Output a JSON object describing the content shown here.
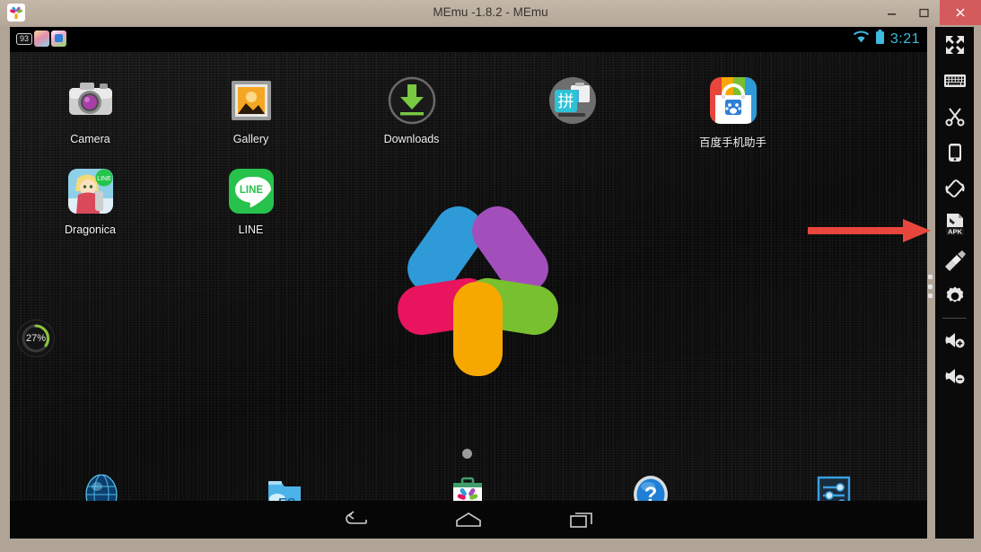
{
  "window": {
    "title": "MEmu -1.8.2 - MEmu",
    "app_icon": "memu-pinwheel-icon",
    "controls": {
      "minimize": "–",
      "maximize": "☐",
      "close": "✕"
    }
  },
  "status_bar": {
    "notification_count": "93",
    "notification_icons": [
      "dragonica-notification-icon",
      "baidu-notification-icon"
    ],
    "wifi_icon": "wifi-icon",
    "battery_icon": "battery-icon",
    "clock": "3:21",
    "accent_color": "#3fb9dd"
  },
  "performance_badge": {
    "value": "27%",
    "arc_color": "#8cc63f"
  },
  "home_screen": {
    "page_indicator_dots": 1,
    "apps": [
      {
        "label": "Camera",
        "icon": "camera-icon"
      },
      {
        "label": "Gallery",
        "icon": "gallery-icon"
      },
      {
        "label": "Downloads",
        "icon": "downloads-icon"
      },
      {
        "label": "",
        "icon": "pinyin-briefcase-icon"
      },
      {
        "label": "百度手机助手",
        "icon": "baidu-mobile-assistant-icon"
      },
      {
        "label": "Dragonica",
        "icon": "dragonica-icon"
      },
      {
        "label": "LINE",
        "icon": "line-icon"
      }
    ],
    "dock": [
      {
        "name": "Browser",
        "icon": "browser-globe-icon"
      },
      {
        "name": "ES File Explorer",
        "icon": "es-file-explorer-icon",
        "badge": "ES"
      },
      {
        "name": "App Store",
        "icon": "appstore-briefcase-icon"
      },
      {
        "name": "Help",
        "icon": "help-question-icon"
      },
      {
        "name": "Settings",
        "icon": "settings-sliders-icon"
      }
    ],
    "nav_bar": [
      {
        "name": "Back",
        "icon": "back-arrow-icon"
      },
      {
        "name": "Home",
        "icon": "home-icon"
      },
      {
        "name": "Recents",
        "icon": "recents-icon"
      }
    ],
    "logo": {
      "name": "memu-pinwheel-logo",
      "petal_colors": [
        "#2f9ad8",
        "#a24fbc",
        "#e8145e",
        "#79c030",
        "#f6a800"
      ]
    }
  },
  "toolbar": {
    "buttons": [
      {
        "name": "fullscreen",
        "icon": "fullscreen-icon"
      },
      {
        "name": "keyboard",
        "icon": "keyboard-icon"
      },
      {
        "name": "screenshot",
        "icon": "scissors-icon"
      },
      {
        "name": "shake",
        "icon": "phone-shake-icon"
      },
      {
        "name": "rotate",
        "icon": "rotate-icon"
      },
      {
        "name": "install-apk",
        "icon": "apk-install-icon",
        "label": "APK"
      },
      {
        "name": "clean",
        "icon": "brush-icon"
      },
      {
        "name": "settings",
        "icon": "gear-icon"
      },
      {
        "name": "volume-up",
        "icon": "volume-up-icon"
      },
      {
        "name": "volume-down",
        "icon": "volume-down-icon"
      }
    ],
    "drag_handle": "three-dot-handle"
  },
  "annotation": {
    "arrow": "red-right-arrow",
    "color": "#e8463c",
    "points_to": "install-apk"
  }
}
